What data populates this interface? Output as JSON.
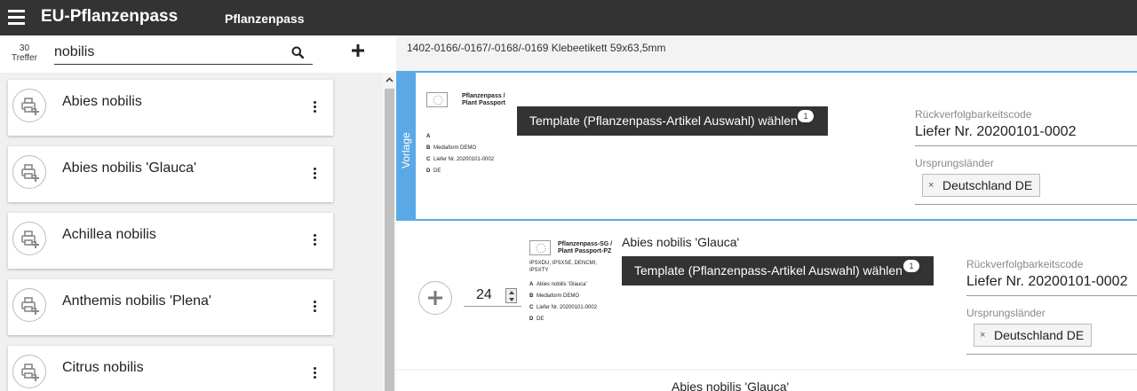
{
  "header": {
    "app_title": "EU-Pflanzenpass",
    "page_title": "Pflanzenpass"
  },
  "search": {
    "hit_count": "30",
    "hit_label": "Treffer",
    "query": "nobilis"
  },
  "results": [
    {
      "name": "Abies nobilis"
    },
    {
      "name": "Abies nobilis 'Glauca'"
    },
    {
      "name": "Achillea nobilis"
    },
    {
      "name": "Anthemis nobilis 'Plena'"
    },
    {
      "name": "Citrus nobilis"
    }
  ],
  "product": {
    "title": "1402-0166/-0167/-0168/-0169 Klebeetikett 59x63,5mm"
  },
  "template_panel": {
    "tab_label": "Vorlage",
    "preview": {
      "title_line1": "Pflanzenpass /",
      "title_line2": "Plant Passport",
      "rows": [
        {
          "key": "A",
          "value": ""
        },
        {
          "key": "B",
          "value": "Mediaform DEMO"
        },
        {
          "key": "C",
          "value": "Liefer Nr. 20200101-0002"
        },
        {
          "key": "D",
          "value": "DE"
        }
      ]
    },
    "button_label": "Template (Pflanzenpass-Artikel Auswahl) wählen",
    "badge": "1",
    "trace_label": "Rückverfolgbarkeitscode",
    "trace_value": "Liefer Nr. 20200101-0002",
    "origin_label": "Ursprungsländer",
    "origin_chip": "Deutschland DE",
    "chip_remove": "×"
  },
  "item_panel": {
    "quantity": "24",
    "article_name": "Abies nobilis 'Glauca'",
    "preview": {
      "title_line1": "Pflanzenpass-SG /",
      "title_line2": "Plant Passport-PZ",
      "codes_line1": "IPSXDU, IPSXSE, DENCMI,",
      "codes_line2": "IPSXTY",
      "rows": [
        {
          "key": "A",
          "value": "Abies nobilis 'Glauca'"
        },
        {
          "key": "B",
          "value": "Mediaform DEMO"
        },
        {
          "key": "C",
          "value": "Liefer Nr. 20200101-0002"
        },
        {
          "key": "D",
          "value": "DE"
        }
      ]
    },
    "button_label": "Template (Pflanzenpass-Artikel Auswahl) wählen",
    "badge": "1",
    "trace_label": "Rückverfolgbarkeitscode",
    "trace_value": "Liefer Nr. 20200101-0002",
    "origin_label": "Ursprungsländer",
    "origin_chip": "Deutschland DE",
    "chip_remove": "×"
  },
  "next_panel": {
    "article_name": "Abies nobilis 'Glauca'"
  },
  "colors": {
    "header_bg": "#333333",
    "accent_blue": "#5aa9e6",
    "button_bg": "#333333"
  }
}
